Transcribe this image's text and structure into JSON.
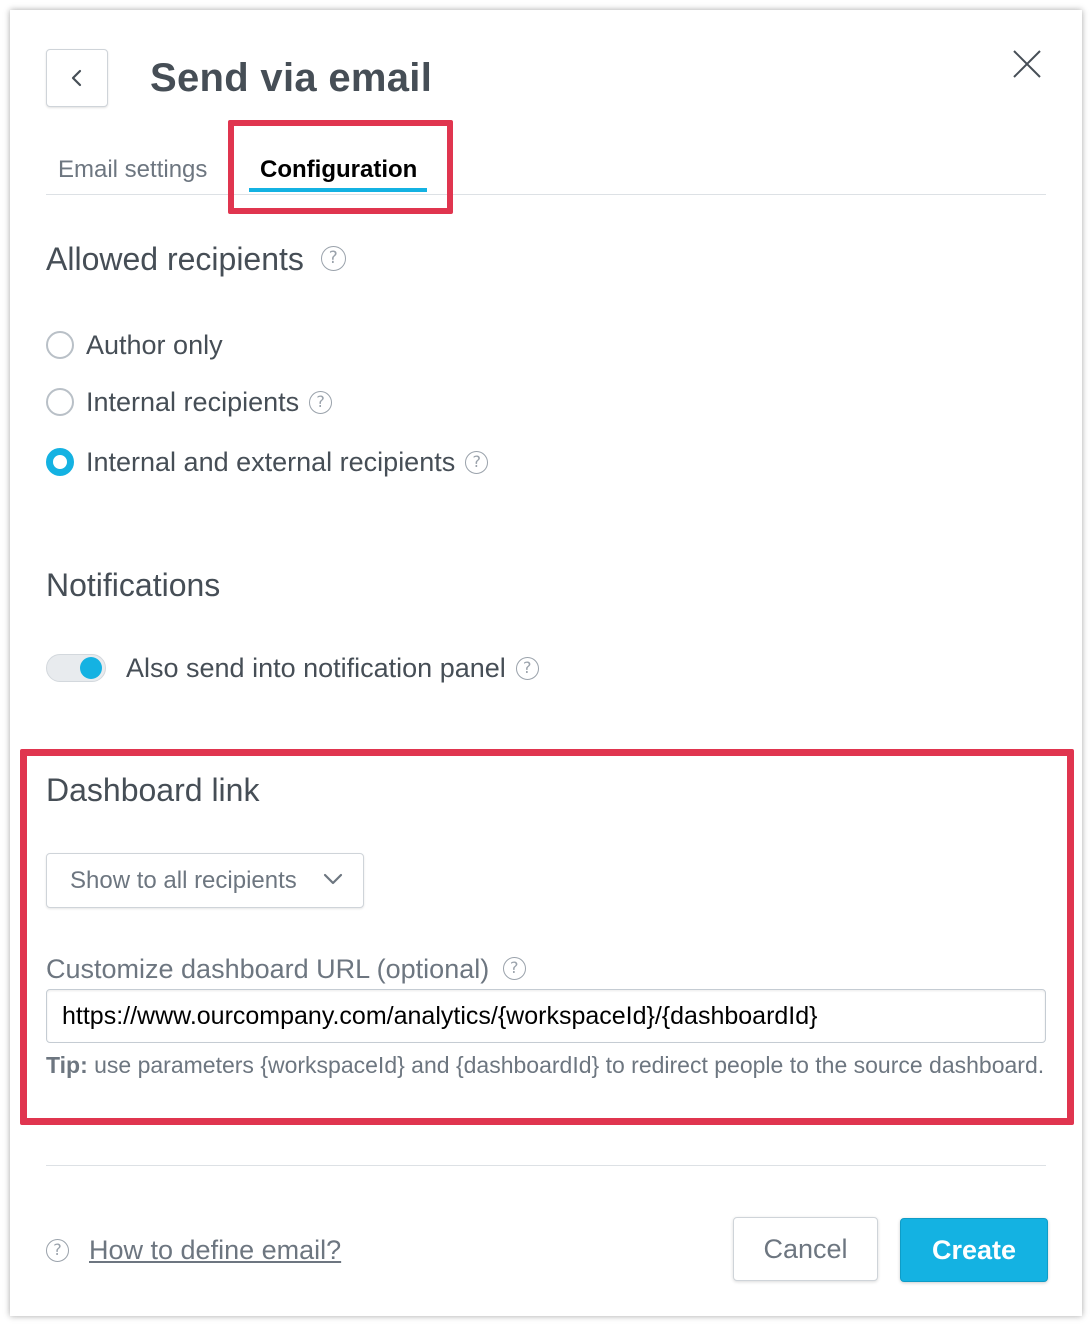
{
  "dialog": {
    "title": "Send via email",
    "back_icon": "chevron-left-icon",
    "close_icon": "close-icon"
  },
  "tabs": [
    {
      "label": "Email settings",
      "active": false
    },
    {
      "label": "Configuration",
      "active": true
    }
  ],
  "recipients": {
    "heading": "Allowed recipients",
    "options": [
      {
        "label": "Author only",
        "selected": false,
        "has_help": false
      },
      {
        "label": "Internal recipients",
        "selected": false,
        "has_help": true
      },
      {
        "label": "Internal and external recipients",
        "selected": true,
        "has_help": true
      }
    ]
  },
  "notifications": {
    "heading": "Notifications",
    "toggle_label": "Also send into notification panel",
    "toggle_on": true
  },
  "dashboard_link": {
    "heading": "Dashboard link",
    "dropdown_value": "Show to all recipients",
    "url_label": "Customize dashboard URL (optional)",
    "url_value": "https://www.ourcompany.com/analytics/{workspaceId}/{dashboardId}",
    "tip_prefix": "Tip:",
    "tip_text": " use parameters {workspaceId} and {dashboardId} to redirect people to the source dashboard."
  },
  "footer": {
    "help_link": "How to define email?",
    "cancel_label": "Cancel",
    "create_label": "Create"
  },
  "help_glyph": "?",
  "colors": {
    "accent": "#14b2e2",
    "highlight": "#e0354f",
    "text": "#464e56"
  }
}
